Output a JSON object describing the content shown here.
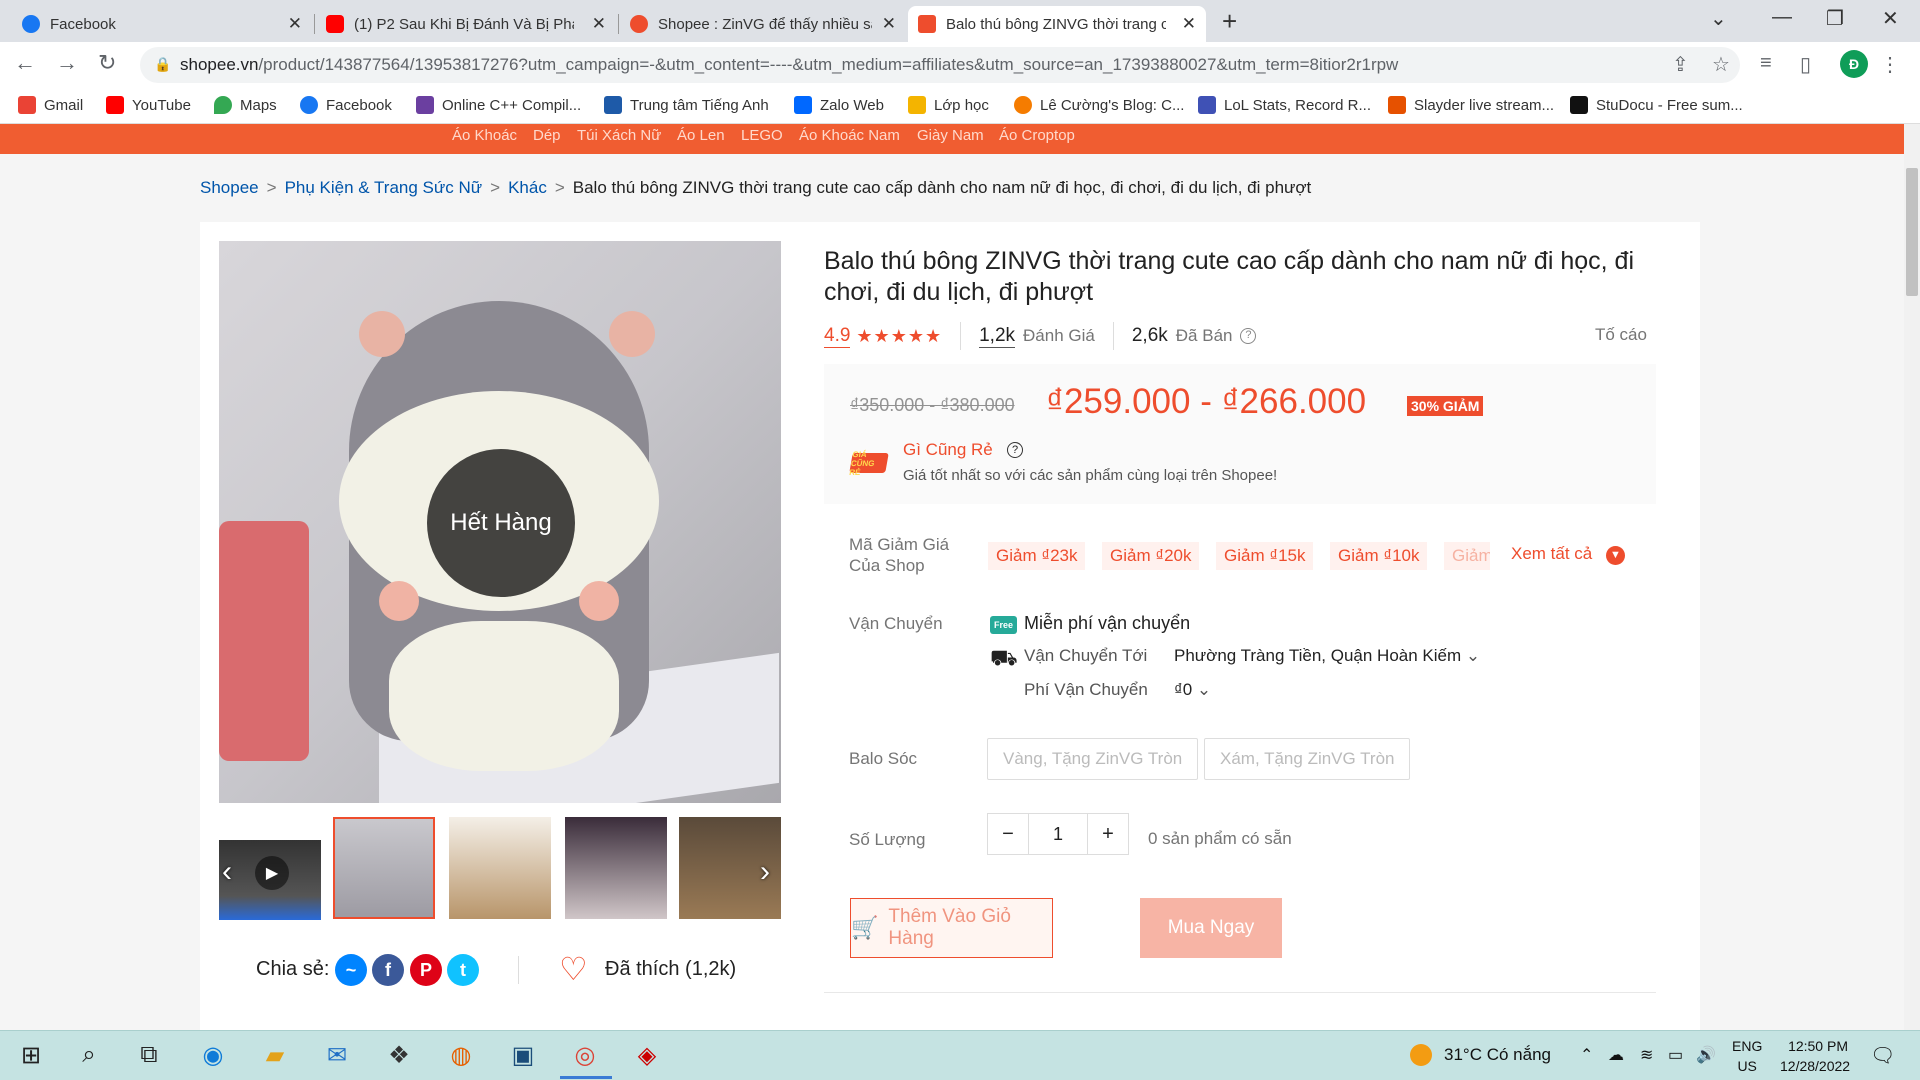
{
  "browser": {
    "tabs": [
      {
        "title": "Facebook",
        "color": "#1877f2"
      },
      {
        "title": "(1) P2 Sau Khi Bị Đánh Và Bị Phá",
        "color": "#ff0000"
      },
      {
        "title": "Shopee : ZinVG để thấy nhiều sản",
        "color": "#ee4d2d"
      },
      {
        "title": "Balo thú bông ZINVG thời trang c",
        "color": "#ee4d2d"
      }
    ],
    "new_tab": "+",
    "url_host": "shopee.vn",
    "url_rest": "/product/143877564/13953817276?utm_campaign=-&utm_content=----&utm_medium=affiliates&utm_source=an_17393880027&utm_term=8itior2r1rpw",
    "avatar_letter": "Đ",
    "bookmarks": [
      {
        "label": "Gmail",
        "color": "#ea4335"
      },
      {
        "label": "YouTube",
        "color": "#ff0000"
      },
      {
        "label": "Maps",
        "color": "#34a853"
      },
      {
        "label": "Facebook",
        "color": "#1877f2"
      },
      {
        "label": "Online C++ Compil...",
        "color": "#6b3fa0"
      },
      {
        "label": "Trung tâm Tiếng Anh",
        "color": "#1e5aa8"
      },
      {
        "label": "Zalo Web",
        "color": "#0068ff"
      },
      {
        "label": "Lớp học",
        "color": "#f4b400"
      },
      {
        "label": "Lê Cường's Blog: C...",
        "color": "#f57c00"
      },
      {
        "label": "LoL Stats, Record R...",
        "color": "#3f51b5"
      },
      {
        "label": "Slayder live stream...",
        "color": "#e65100"
      },
      {
        "label": "StuDocu - Free sum...",
        "color": "#111111"
      }
    ]
  },
  "header": {
    "keywords": [
      "Áo Khoác",
      "Dép",
      "Túi Xách Nữ",
      "Áo Len",
      "LEGO",
      "Áo Khoác Nam",
      "Giày Nam",
      "Áo Croptop"
    ]
  },
  "breadcrumb": {
    "items": [
      "Shopee",
      "Phụ Kiện & Trang Sức Nữ",
      "Khác"
    ],
    "current": "Balo thú bông ZINVG thời trang cute cao cấp dành cho nam nữ đi học, đi chơi, đi du lịch, đi phượt",
    "separator": ">"
  },
  "product": {
    "title": "Balo thú bông ZINVG thời trang cute cao cấp dành cho nam nữ đi học, đi chơi, đi du lịch, đi phượt",
    "rating": "4.9",
    "stars": "★★★★★",
    "review_count": "1,2k",
    "review_label": "Đánh Giá",
    "sold_count": "2,6k",
    "sold_label": "Đã Bán",
    "report": "Tố cáo",
    "old_price": "₫350.000 - ₫380.000",
    "price": "₫259.000 - ₫266.000",
    "discount": "30% GIẢM",
    "gia_cung_re": {
      "logo": "GIÁ CŨNG RẺ",
      "title": "Gì Cũng Rẻ",
      "subtitle": "Giá tốt nhất so với các sản phẩm cùng loại trên Shopee!"
    },
    "sold_out": "Hết Hàng",
    "share_label": "Chia sẻ:",
    "liked": "Đã thích (1,2k)"
  },
  "vouchers": {
    "label": "Mã Giảm Giá Của Shop",
    "items": [
      "Giảm ₫23k",
      "Giảm ₫20k",
      "Giảm ₫15k",
      "Giảm ₫10k",
      "Giảm"
    ],
    "see_all": "Xem tất cả"
  },
  "shipping": {
    "label": "Vận Chuyển",
    "free_badge": "Free",
    "free": "Miễn phí vận chuyển",
    "to_label": "Vận Chuyển Tới",
    "to_value": "Phường Tràng Tiền, Quận Hoàn Kiếm",
    "fee_label": "Phí Vận Chuyển",
    "fee_value": "₫0"
  },
  "variant": {
    "label": "Balo Sóc",
    "options": [
      "Vàng, Tặng ZinVG Tròn",
      "Xám, Tặng ZinVG Tròn"
    ]
  },
  "quantity": {
    "label": "Số Lượng",
    "minus": "−",
    "value": "1",
    "plus": "+",
    "stock": "0 sản phẩm có sẵn"
  },
  "actions": {
    "add_to_cart": "Thêm Vào Giỏ Hàng",
    "buy_now": "Mua Ngay"
  },
  "taskbar": {
    "temperature": "31°C",
    "weather": "Có nắng",
    "lang_1": "ENG",
    "lang_2": "US",
    "time": "12:50 PM",
    "date": "12/28/2022"
  }
}
